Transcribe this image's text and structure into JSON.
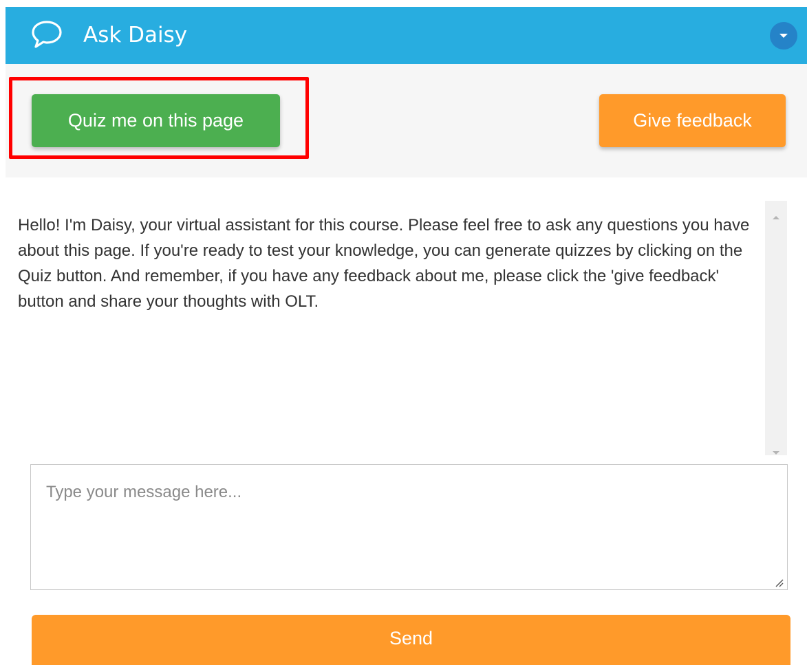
{
  "header": {
    "title": "Ask Daisy",
    "icon": "chat-bubble-icon",
    "dropdown_icon": "chevron-down-icon",
    "background": "#28ade0"
  },
  "toolbar": {
    "quiz_label": "Quiz me on this page",
    "feedback_label": "Give feedback",
    "quiz_color": "#4caf50",
    "feedback_color": "#ff9a2a",
    "highlight_color": "#ff0000"
  },
  "message": {
    "text": "Hello! I'm Daisy, your virtual assistant for this course. Please feel free to ask any questions you have about this page. If you're ready to test your knowledge, you can generate quizzes by clicking on the Quiz button. And remember, if you have any feedback about me, please click the 'give feedback' button and share your thoughts with OLT."
  },
  "input": {
    "placeholder": "Type your message here...",
    "value": ""
  },
  "send": {
    "label": "Send",
    "color": "#ff9a2a"
  }
}
